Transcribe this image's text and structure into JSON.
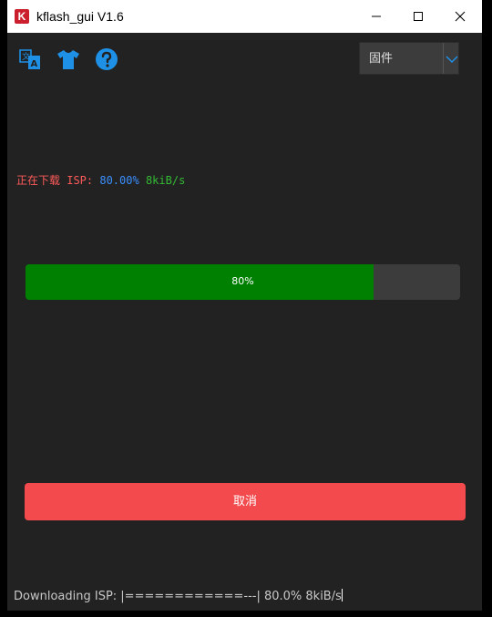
{
  "window": {
    "app_icon_letter": "K",
    "title": "kflash_gui V1.6",
    "controls": [
      "minimize-icon",
      "maximize-icon",
      "close-icon"
    ]
  },
  "toolbar": {
    "icons": [
      "translate-icon",
      "skin-shirt-icon",
      "help-icon"
    ],
    "accent_color": "#1e90e6"
  },
  "firmware_select": {
    "selected": "固件"
  },
  "status": {
    "prefix": "正在下载 ISP: ",
    "percent_text": "80.00%",
    "rate_text": " 8kiB/s"
  },
  "progress": {
    "value": 0.8,
    "label": "80%",
    "fill_color": "#008000"
  },
  "cancel_button": {
    "label": "取消",
    "color": "#f24a4d"
  },
  "footer_log": {
    "text": "Downloading ISP: |============---| 80.0% 8kiB/s"
  }
}
